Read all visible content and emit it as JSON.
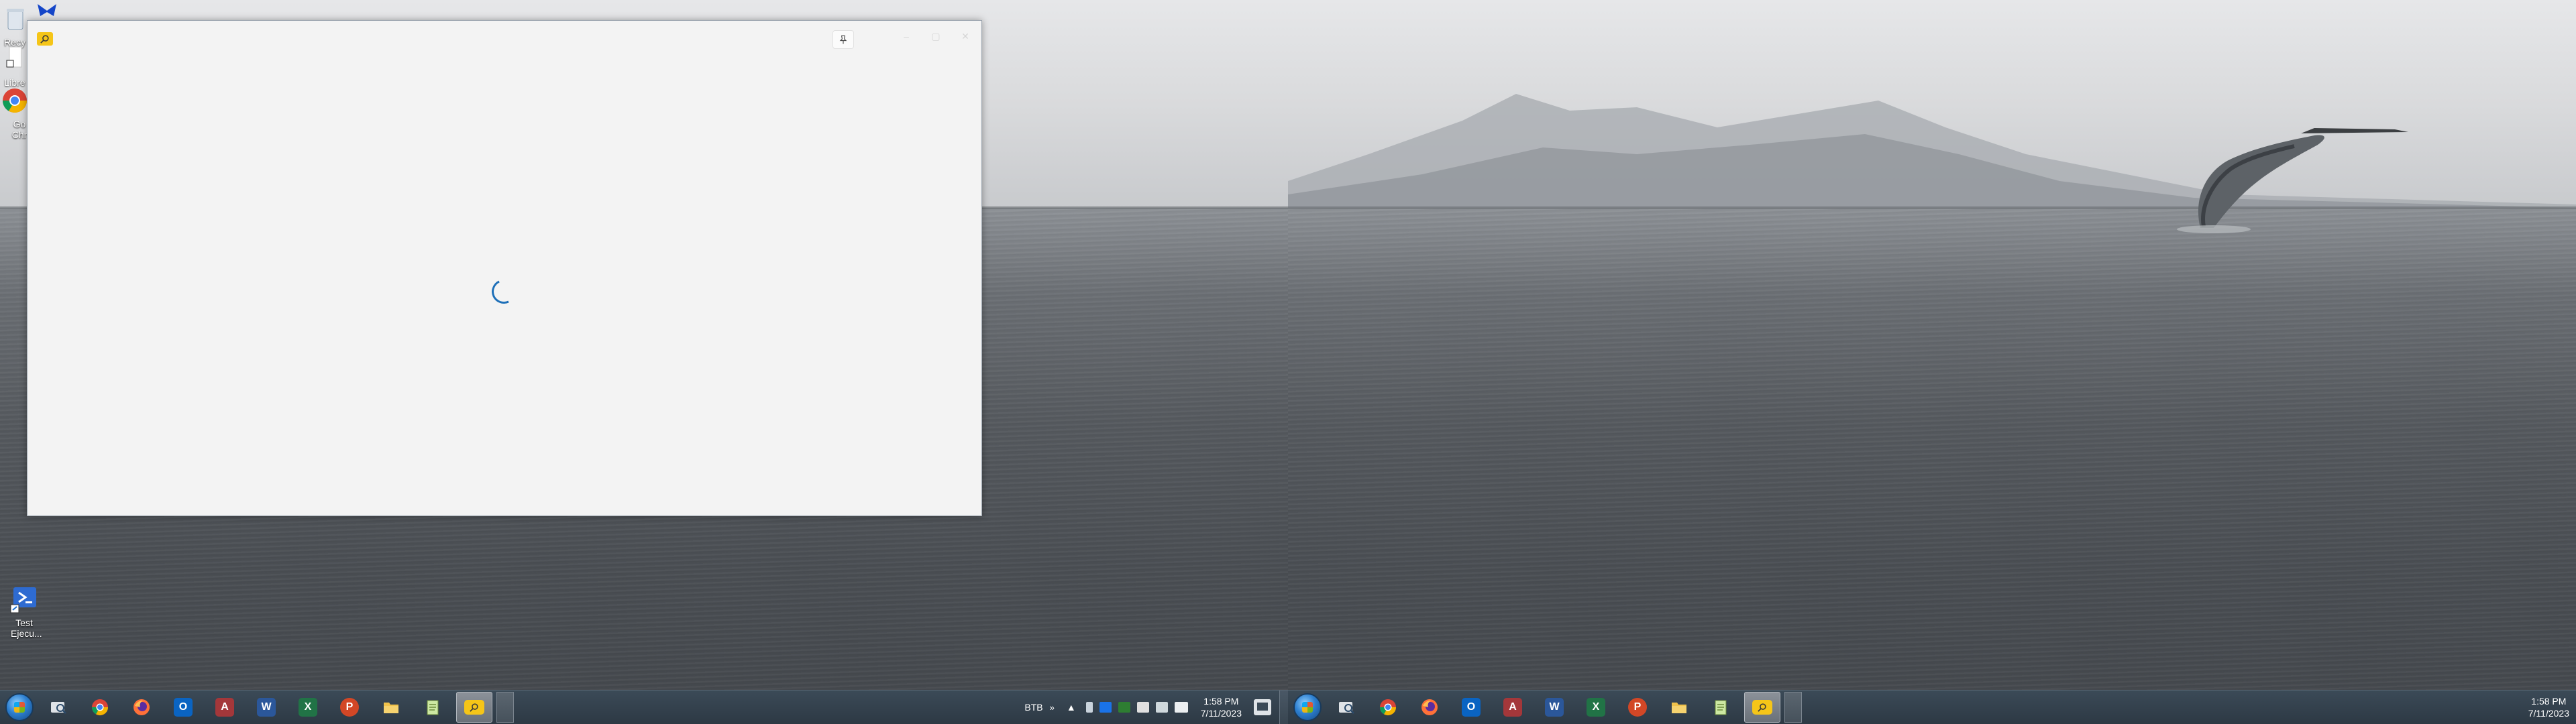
{
  "left_monitor": {
    "desktop_icons": [
      {
        "label": "Recy",
        "icon": "recycle-bin-icon"
      },
      {
        "label": "Libre",
        "icon": "libreoffice-icon"
      },
      {
        "label": "Go Chr",
        "icon": "chrome-icon"
      },
      {
        "label": "Test Ejecu...",
        "icon": "powershell-script-icon"
      }
    ],
    "window": {
      "app_icon": "search-app-icon",
      "pin_icon": "pin-icon",
      "state": "loading"
    },
    "taskbar": {
      "pinned_apps": [
        {
          "name": "start",
          "icon": "windows-orb-icon"
        },
        {
          "name": "search-everything",
          "icon": "magnifier-folder-icon"
        },
        {
          "name": "chrome",
          "icon": "chrome-icon"
        },
        {
          "name": "firefox",
          "icon": "firefox-icon"
        },
        {
          "name": "outlook",
          "icon": "outlook-icon",
          "glyph": "O",
          "color": "#0a64c2"
        },
        {
          "name": "access",
          "icon": "access-icon",
          "glyph": "A",
          "color": "#a4373a"
        },
        {
          "name": "word",
          "icon": "word-icon",
          "glyph": "W",
          "color": "#2b579a"
        },
        {
          "name": "excel",
          "icon": "excel-icon",
          "glyph": "X",
          "color": "#217346"
        },
        {
          "name": "powerpoint",
          "icon": "powerpoint-icon",
          "glyph": "P",
          "color": "#d24726"
        },
        {
          "name": "file-explorer",
          "icon": "folder-icon"
        },
        {
          "name": "notepad",
          "icon": "notepad-icon"
        },
        {
          "name": "search-app",
          "icon": "search-app-icon",
          "active": true
        }
      ],
      "tray": {
        "language": "BTB",
        "chevron": "»",
        "overflow_arrow": "▲",
        "time": "1:58 PM",
        "date": "7/11/2023"
      }
    }
  },
  "right_monitor": {
    "taskbar": {
      "time": "1:58 PM",
      "date": "7/11/2023"
    }
  }
}
